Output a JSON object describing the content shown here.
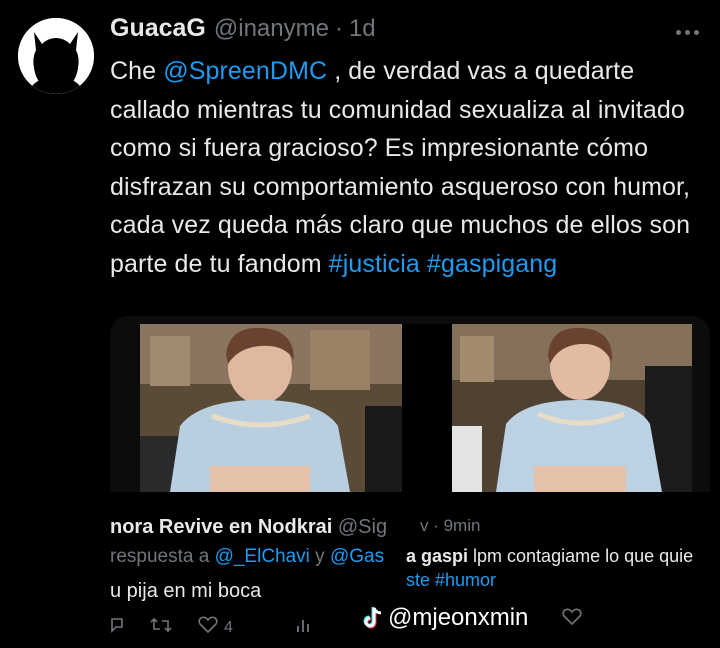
{
  "author": {
    "display_name": "GuacaG",
    "handle": "@inanyme",
    "separator": "·",
    "time": "1d"
  },
  "tweet": {
    "text_before": "Che ",
    "mention": "@SpreenDMC",
    "text_after": " , de verdad vas a quedarte callado mientras tu comunidad sexualiza al invitado como si fuera gracioso? Es impresionante cómo disfrazan su comportamiento asqueroso con humor, cada vez queda más claro que muchos de ellos son parte de tu fandom ",
    "hashtag1": "#justicia",
    "hashtag2": "#gaspigang"
  },
  "media": {
    "reply_left": {
      "name": "nora Revive en Nodkrai",
      "handle": "@Sig",
      "reply_to_prefix": "respuesta a ",
      "reply_to_mention1": "@_ElChavi",
      "reply_to_and": " y ",
      "reply_to_mention2": "@Gas",
      "text": "u pija en mi boca",
      "like_count": "4"
    },
    "reply_right": {
      "time": "v · 9min",
      "name": "a gaspi",
      "text": " lpm contagiame lo que quie",
      "hashtag": "ste #humor"
    }
  },
  "watermark": {
    "text": "@mjeonxmin",
    "icon": "tiktok-icon"
  },
  "colors": {
    "background": "#000000",
    "text": "#e7e9ea",
    "muted": "#71767b",
    "link": "#1d9bf0"
  }
}
